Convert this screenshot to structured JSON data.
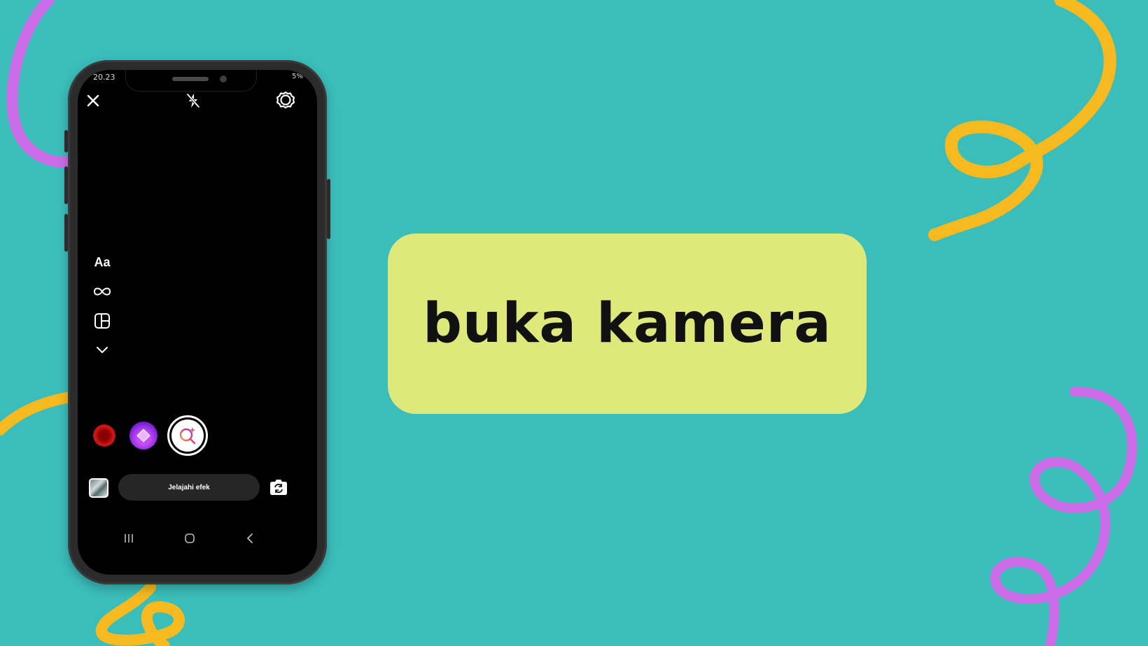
{
  "colors": {
    "background": "#3bbdba",
    "card": "#dfe87a",
    "squiggle_purple": "#cc6be8",
    "squiggle_orange": "#f7b920"
  },
  "phone": {
    "status_time": "20.23",
    "status_right": "5%",
    "top_bar": {
      "close_icon": "close-icon",
      "flash_icon": "flash-off-icon",
      "settings_icon": "settings-icon"
    },
    "tools": {
      "text_tool": "Aa",
      "boomerang_icon": "infinity-icon",
      "layout_icon": "layout-icon",
      "more_icon": "chevron-down-icon"
    },
    "explore_effects_label": "Jelajahi efek",
    "nav": [
      "recents-icon",
      "home-icon",
      "back-icon"
    ]
  },
  "caption": "buka kamera"
}
